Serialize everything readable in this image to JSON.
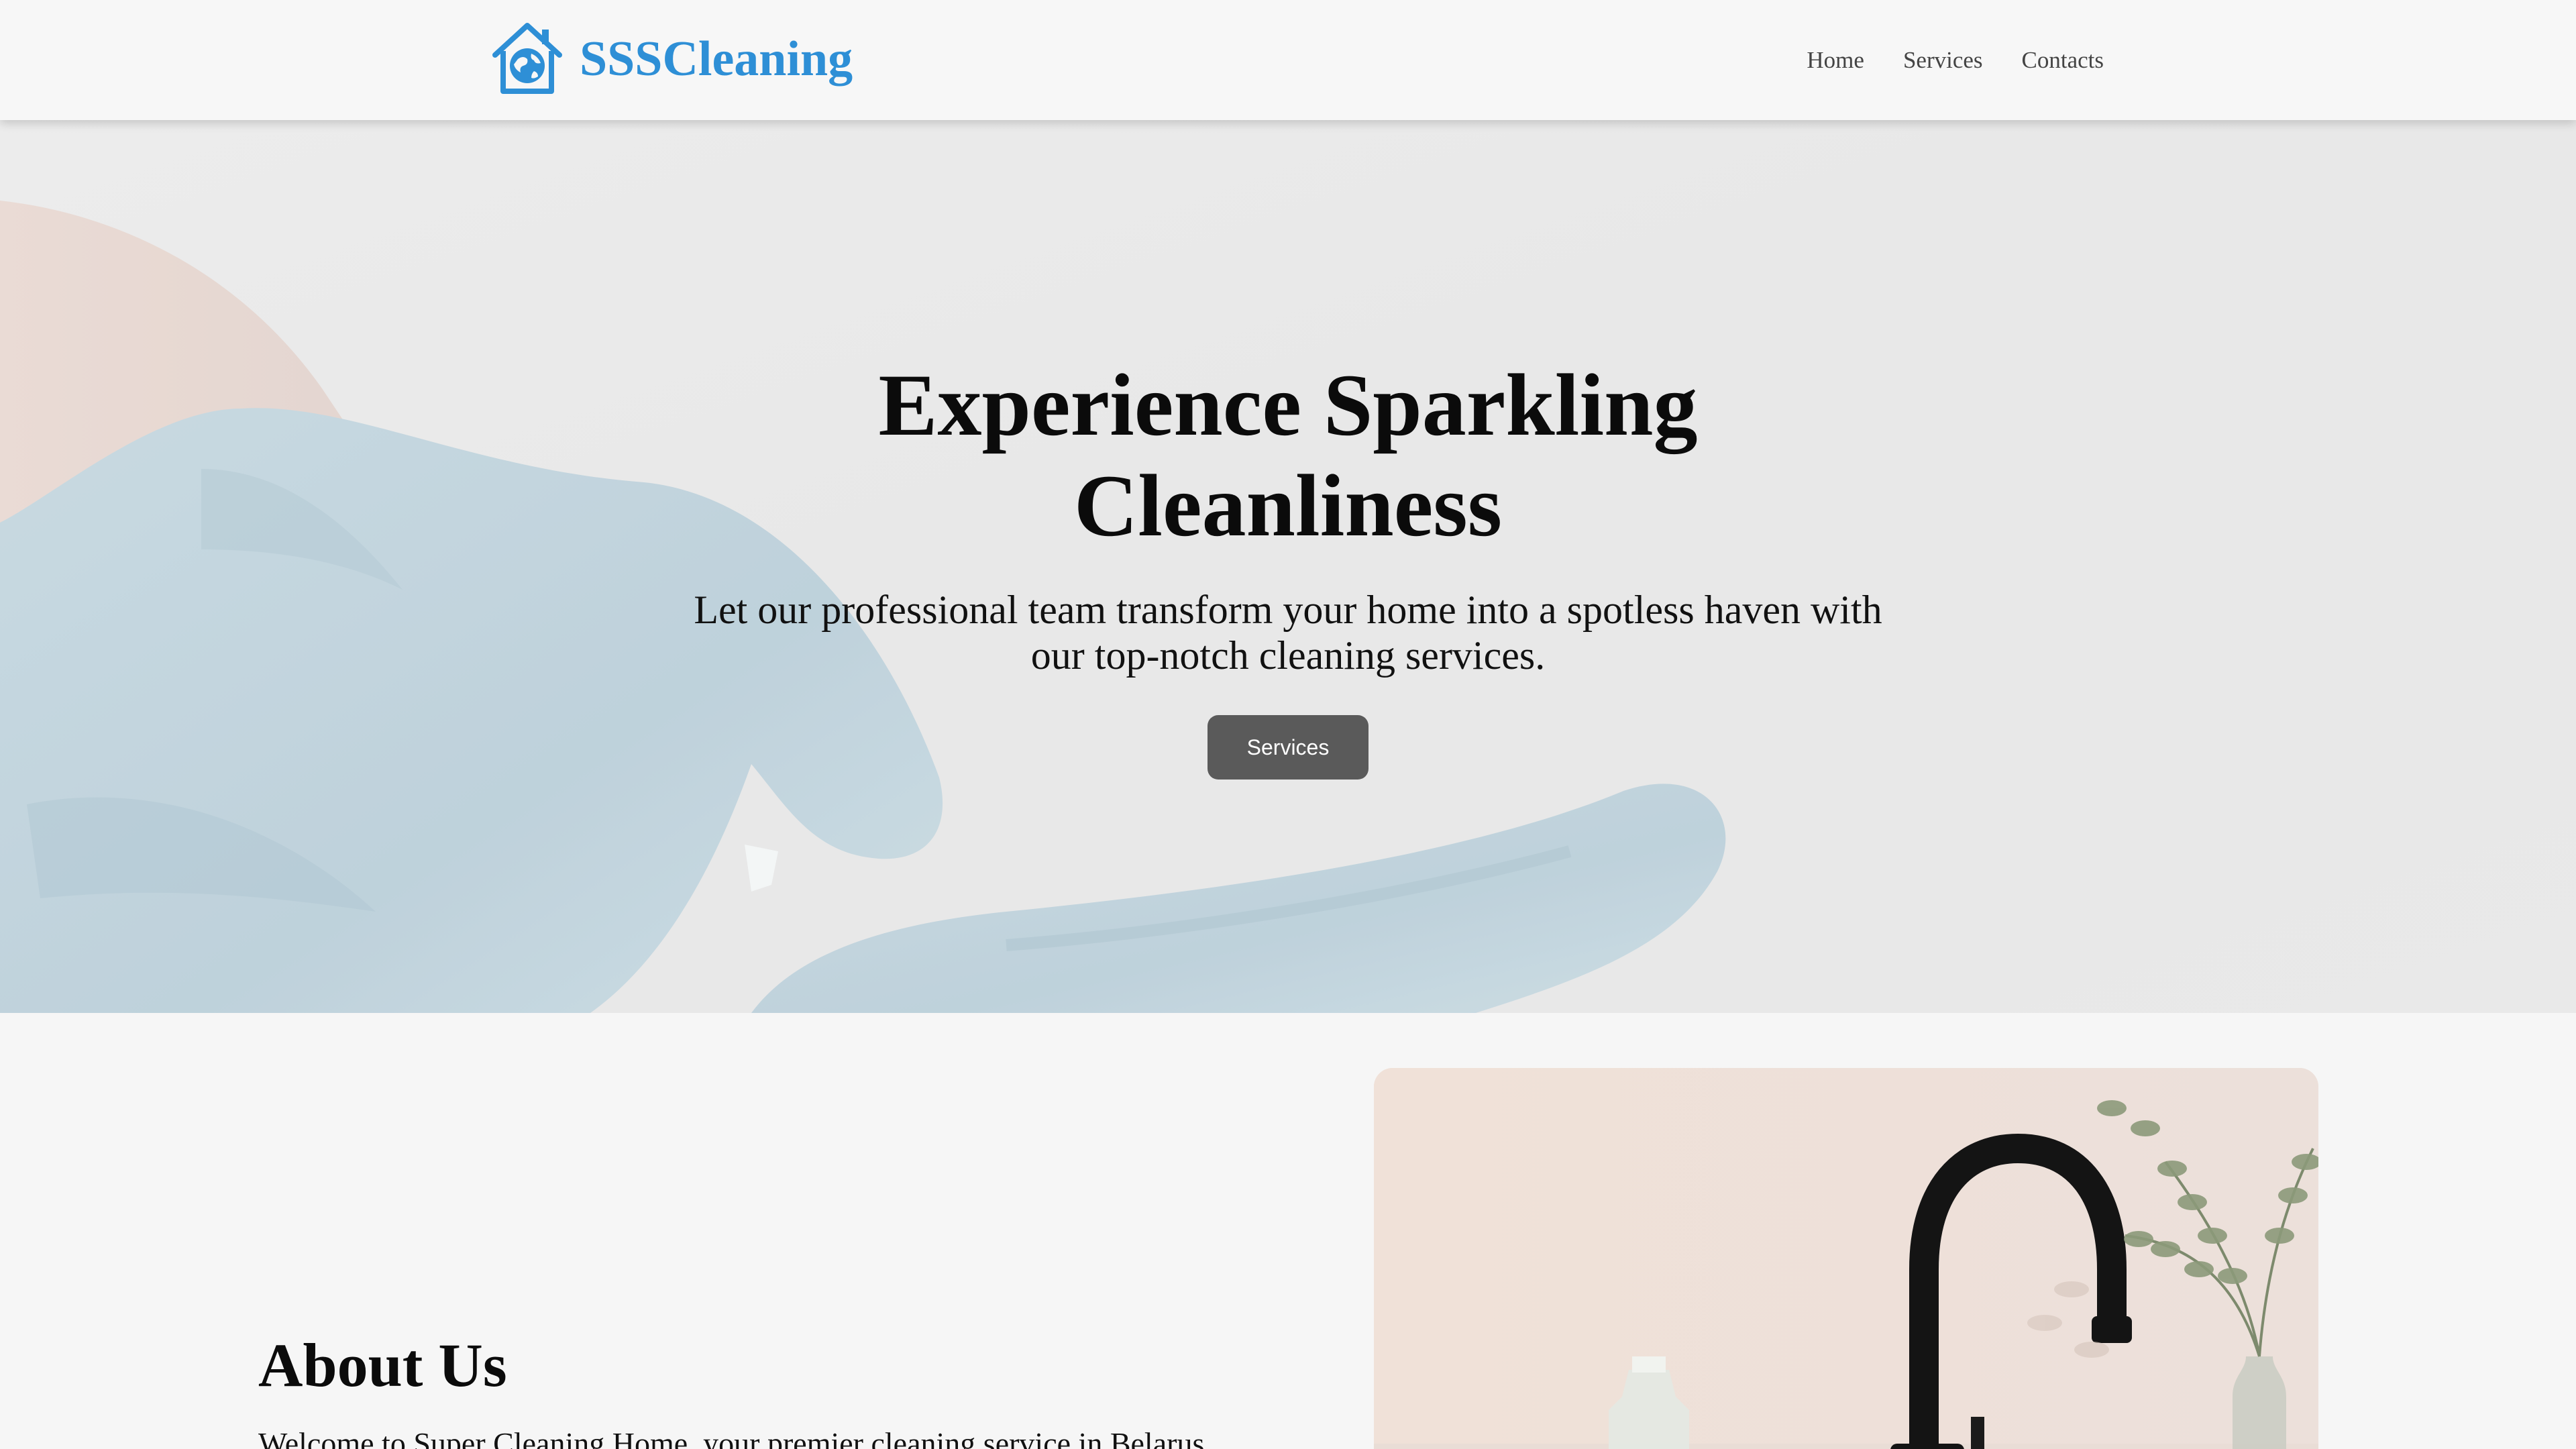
{
  "header": {
    "brand": {
      "name": "SSSCleaning",
      "icon": "house-globe-icon",
      "color": "#2e8fd6"
    },
    "nav": [
      {
        "label": "Home"
      },
      {
        "label": "Services"
      },
      {
        "label": "Contacts"
      }
    ]
  },
  "hero": {
    "title": "Experience Sparkling Cleanliness",
    "subtitle": "Let our professional team transform your home into a spotless haven with our top-notch cleaning services.",
    "button_label": "Services",
    "background": "gloved-hands-photo"
  },
  "about": {
    "title": "About Us",
    "text": "Welcome to Super Cleaning Home, your premier cleaning service in Belarus.",
    "image": "black-faucet-with-eucalyptus-photo"
  }
}
